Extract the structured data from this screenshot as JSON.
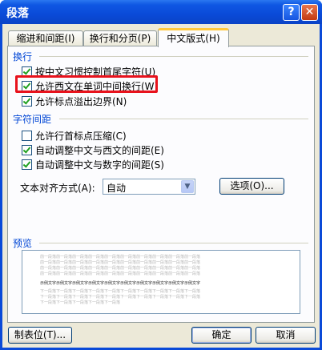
{
  "window": {
    "title": "段落"
  },
  "titlebar": {
    "help_glyph": "?",
    "close_glyph": "✕"
  },
  "tabs": [
    {
      "label": "缩进和间距(I)"
    },
    {
      "label": "换行和分页(P)"
    },
    {
      "label": "中文版式(H)"
    }
  ],
  "wrap": {
    "title": "换行",
    "items": [
      {
        "label": "按中文习惯控制首尾字符(U)",
        "checked": true
      },
      {
        "label": "允许西文在单词中间换行(W)",
        "checked": true
      },
      {
        "label": "允许标点溢出边界(N)",
        "checked": true
      }
    ]
  },
  "spacing": {
    "title": "字符间距",
    "items": [
      {
        "label": "允许行首标点压缩(C)",
        "checked": false
      },
      {
        "label": "自动调整中文与西文的间距(E)",
        "checked": true
      },
      {
        "label": "自动调整中文与数字的间距(S)",
        "checked": true
      }
    ]
  },
  "align": {
    "label": "文本对齐方式(A):",
    "value": "自动",
    "options_label": "选项(O)..."
  },
  "preview": {
    "title": "预览",
    "gray_line": "前一段落前一段落前一段落前一段落前一段落前一段落前一段落前一段落前一段落前一段落",
    "gray_line_short": "前一段落前一段落前一段落前一段落前一段落",
    "sample_line": "示例文字示例文字示例文字示例文字示例文字示例文字示例文字示例文字示例文字示例文字",
    "after_line": "下一段落下一段落下一段落下一段落下一段落下一段落下一段落下一段落下一段落下一段落",
    "after_line_short": "下一段落下一段落下一段落下一段落下一段落"
  },
  "footer": {
    "tabs_label": "制表位(T)...",
    "ok_label": "确定",
    "cancel_label": "取消"
  },
  "colors": {
    "titlebar": "#0a4ad8",
    "section_title": "#0046d5",
    "highlight": "#e8121c",
    "face": "#ece9d8"
  }
}
